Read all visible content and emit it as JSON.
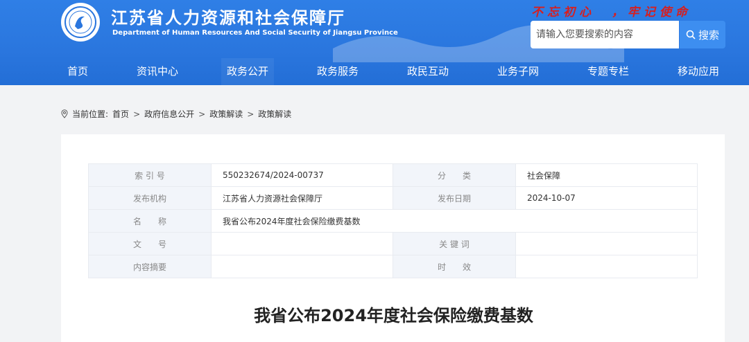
{
  "header": {
    "title": "江苏省人力资源和社会保障厅",
    "subtitle": "Department of Human Resources And Social Security of Jiangsu Province",
    "slogan": "不忘初心  ，牢记使命",
    "search": {
      "placeholder": "请输入您要搜索的内容",
      "button_label": "搜索",
      "icon": "search-icon"
    }
  },
  "nav": {
    "items": [
      {
        "label": "首页"
      },
      {
        "label": "资讯中心"
      },
      {
        "label": "政务公开"
      },
      {
        "label": "政务服务"
      },
      {
        "label": "政民互动"
      },
      {
        "label": "业务子网"
      },
      {
        "label": "专题专栏"
      },
      {
        "label": "移动应用"
      }
    ],
    "active": "政务公开"
  },
  "breadcrumb": {
    "icon": "location-pin-icon",
    "prefix": "当前位置:",
    "items": [
      "首页",
      "政府信息公开",
      "政策解读",
      "政策解读"
    ],
    "separator": ">"
  },
  "meta": {
    "index_label": "索 引 号",
    "index_value": "550232674/2024-00737",
    "category_label": "分　　类",
    "category_value": "社会保障",
    "publisher_label": "发布机构",
    "publisher_value": "江苏省人力资源社会保障厅",
    "date_label": "发布日期",
    "date_value": "2024-10-07",
    "name_label": "名　　称",
    "name_value": "我省公布2024年度社会保险缴费基数",
    "docno_label": "文　　号",
    "docno_value": "",
    "keywords_label": "关 键 词",
    "keywords_value": "",
    "summary_label": "内容摘要",
    "summary_value": "",
    "validity_label": "时　　效",
    "validity_value": ""
  },
  "article": {
    "title": "我省公布2024年度社会保险缴费基数"
  },
  "colors": {
    "header_blue": "#2a76de",
    "slogan_red": "#d81e1e",
    "label_bg": "#f2f5fa"
  }
}
